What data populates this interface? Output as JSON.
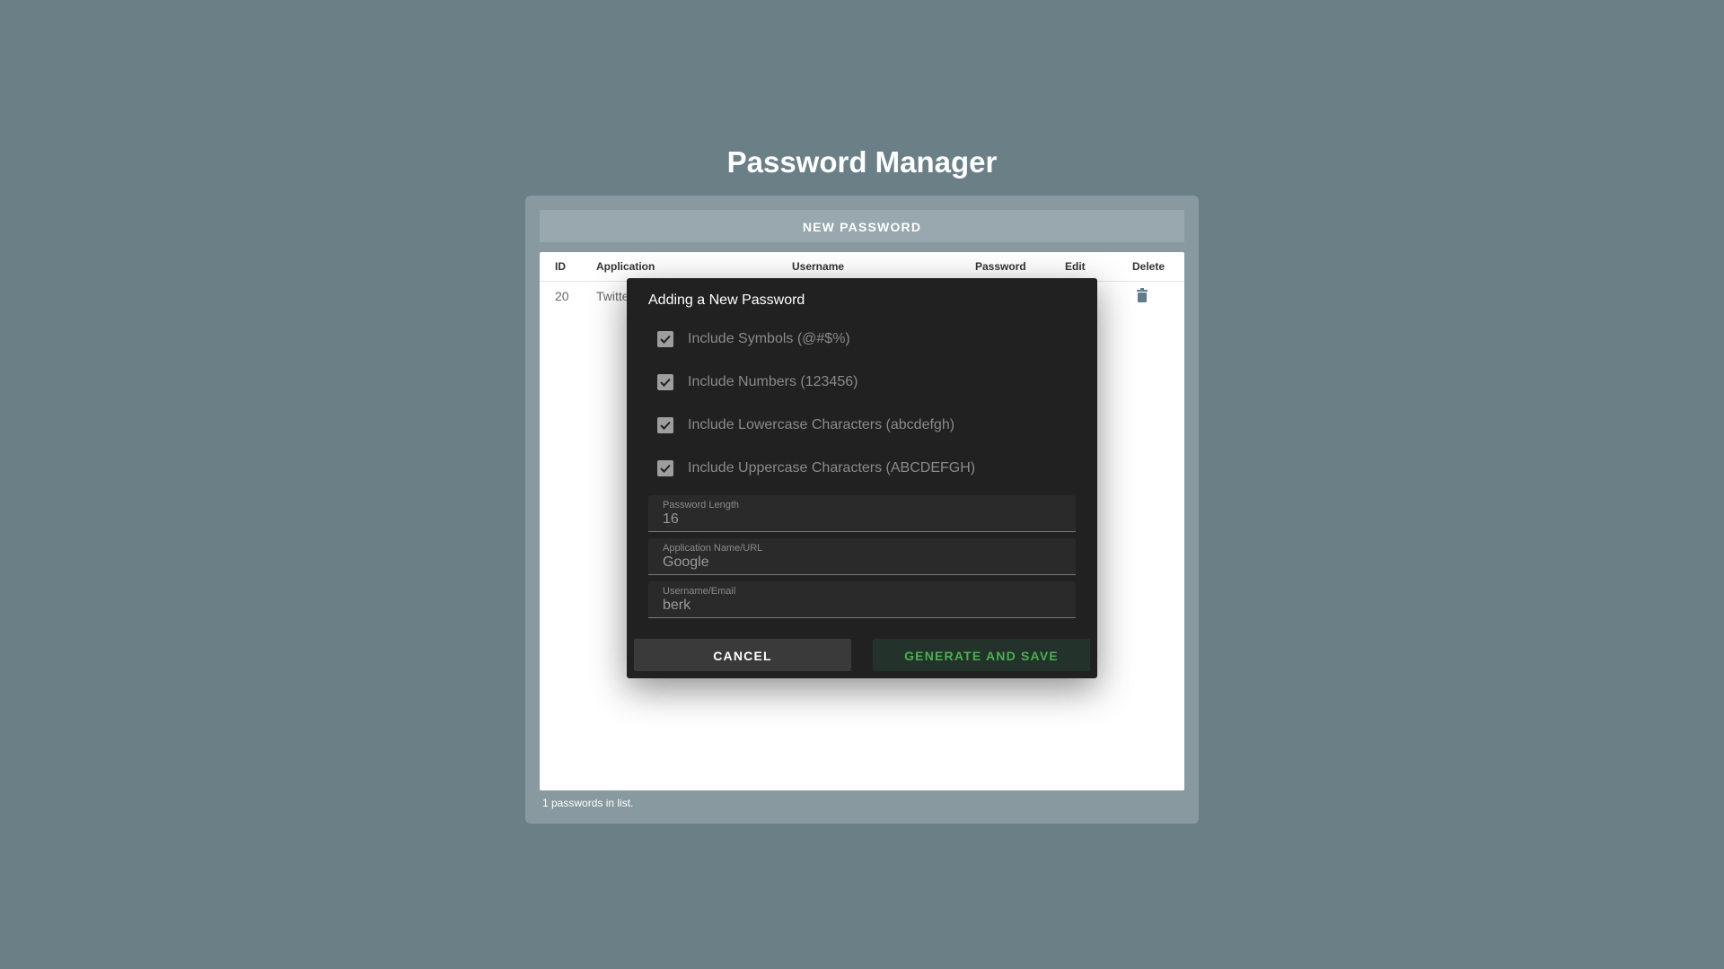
{
  "app": {
    "title": "Password Manager"
  },
  "toolbar": {
    "new_password_label": "NEW PASSWORD"
  },
  "table": {
    "columns": {
      "id": "ID",
      "application": "Application",
      "username": "Username",
      "password": "Password",
      "edit": "Edit",
      "delete": "Delete"
    },
    "rows": [
      {
        "id": "20",
        "application": "Twitte"
      }
    ]
  },
  "footer": {
    "count_text": "1 passwords in list."
  },
  "dialog": {
    "title": "Adding a New Password",
    "options": [
      {
        "label": "Include Symbols (@#$%)",
        "checked": true
      },
      {
        "label": "Include Numbers (123456)",
        "checked": true
      },
      {
        "label": "Include Lowercase Characters (abcdefgh)",
        "checked": true
      },
      {
        "label": "Include Uppercase Characters (ABCDEFGH)",
        "checked": true
      }
    ],
    "fields": {
      "length": {
        "label": "Password Length",
        "value": "16"
      },
      "application": {
        "label": "Application Name/URL",
        "value": "Google"
      },
      "username": {
        "label": "Username/Email",
        "value": "berk"
      }
    },
    "cancel_label": "CANCEL",
    "generate_label": "GENERATE AND SAVE"
  },
  "colors": {
    "background": "#6b7f87",
    "panel": "#88999f",
    "dialog": "#212121",
    "accent_green": "#4caf50"
  },
  "icons": {
    "delete": "trash-icon",
    "checkbox": "check-icon"
  }
}
